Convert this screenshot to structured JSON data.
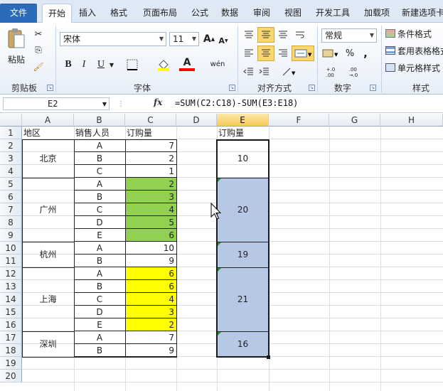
{
  "tabs": [
    "文件",
    "开始",
    "插入",
    "格式",
    "页面布局",
    "公式",
    "数据",
    "审阅",
    "视图",
    "开发工具",
    "加载项",
    "新建选项卡"
  ],
  "ribbon": {
    "paste_label": "粘贴",
    "clipboard_label": "剪贴板",
    "font_name": "宋体",
    "font_size": "11",
    "font_group_label": "字体",
    "bold": "B",
    "italic": "I",
    "underline": "U",
    "font_color_letter": "A",
    "phonetic": "wén",
    "align_group_label": "对齐方式",
    "number_format": "常规",
    "number_group_label": "数字",
    "percent": "%",
    "comma": ",",
    "decimal_inc": "+.0\n.00",
    "decimal_dec": ".00\n→.0",
    "cond_format": "条件格式",
    "table_format": "套用表格格式",
    "cell_style": "单元格样式",
    "styles_group_label": "样式"
  },
  "formula_bar": {
    "name_box": "E2",
    "fx": "fx",
    "formula": "=SUM(C2:C18)-SUM(E3:E18)"
  },
  "sheet": {
    "columns": [
      "A",
      "B",
      "C",
      "D",
      "E",
      "F",
      "G",
      "H"
    ],
    "rows": [
      "1",
      "2",
      "3",
      "4",
      "5",
      "6",
      "7",
      "8",
      "9",
      "10",
      "11",
      "12",
      "13",
      "14",
      "15",
      "16",
      "17",
      "18",
      "19",
      "20"
    ],
    "headers": {
      "region": "地区",
      "salesperson": "销售人员",
      "orders": "订购量",
      "orders_e": "订购量"
    },
    "regions": [
      "北京",
      "广州",
      "杭州",
      "上海",
      "深圳"
    ],
    "salespersons": [
      "A",
      "B",
      "C",
      "A",
      "B",
      "C",
      "D",
      "E",
      "A",
      "B",
      "A",
      "B",
      "C",
      "D",
      "E",
      "A",
      "B"
    ],
    "orders": [
      "7",
      "2",
      "1",
      "2",
      "3",
      "4",
      "5",
      "6",
      "10",
      "9",
      "6",
      "6",
      "4",
      "3",
      "2",
      "7",
      "9"
    ],
    "subtotals": [
      "10",
      "20",
      "19",
      "21",
      "16"
    ]
  },
  "colors": {
    "green_fill": "#92d050",
    "yellow_fill": "#ffff00",
    "blue_fill": "#b7c7e6",
    "selected_header": "#f7c95a",
    "file_tab": "#2a6ab8"
  }
}
